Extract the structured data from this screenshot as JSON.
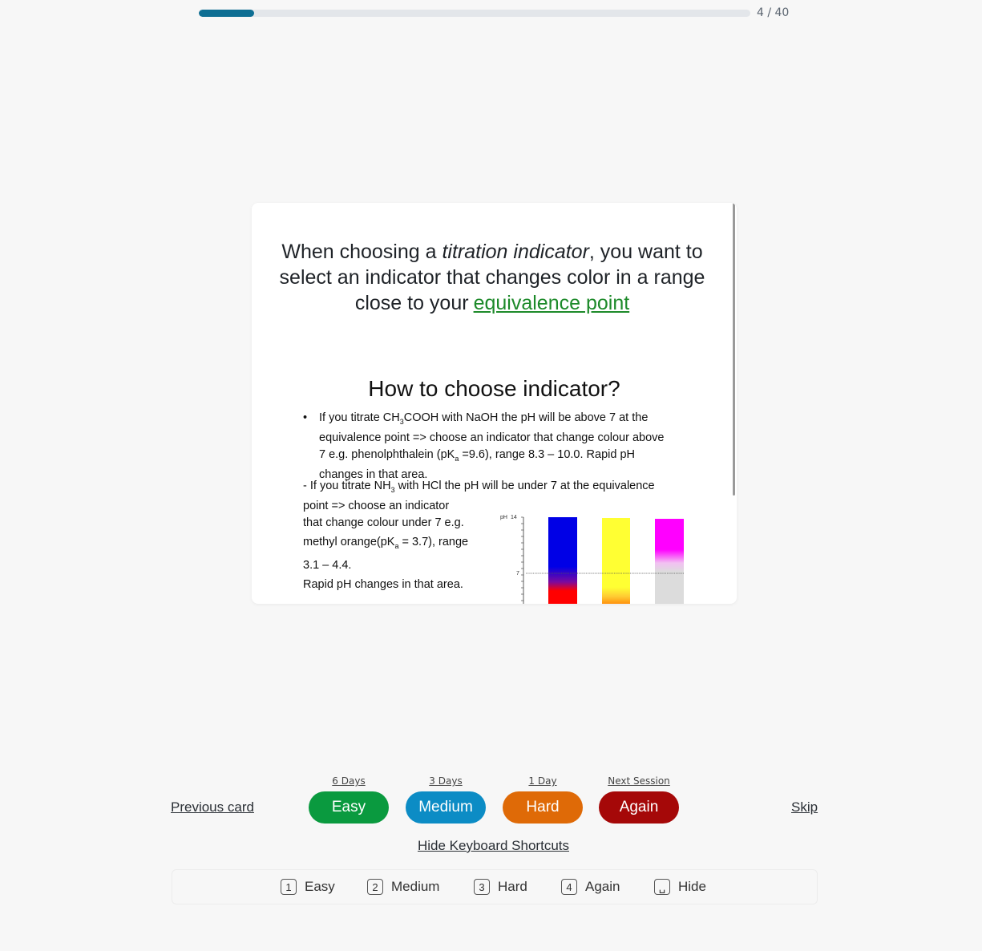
{
  "progress": {
    "current_label": "4 / 40",
    "fraction": 0.1
  },
  "card": {
    "question_pre": "When choosing a ",
    "question_term": "titration indicator",
    "question_mid": ", you want to select an indicator that changes color in a range close to your",
    "question_link": "equivalence point",
    "slide": {
      "title": "How to choose indicator?",
      "bullet_a": "If you titrate CH",
      "bullet_sub1": "3",
      "bullet_b": "COOH with NaOH the pH will be above 7 at the equivalence point => choose an indicator that change colour above 7 e.g. phenolphthalein (pK",
      "bullet_sub2": "a",
      "bullet_c": " =9.6), range 8.3 – 10.0. Rapid pH changes in that area.",
      "para2_a": "- If you titrate NH",
      "para2_sub": "3",
      "para2_b": " with HCl the pH will be under 7 at the equivalence point => choose an indicator",
      "para3_line1": "that change colour under 7 e.g.",
      "para3_line2a": "methyl orange(pK",
      "para3_sub": "a",
      "para3_line2b": " = 3.7), range",
      "para3_line3": "3.1 – 4.4.",
      "para3_line4": "Rapid pH changes in that area.",
      "chart_ph_label": "pH",
      "chart_tick_14": "14",
      "chart_tick_7": "7"
    }
  },
  "rating": {
    "easy": {
      "interval": "6 Days",
      "label": "Easy",
      "color": "#0a9a3f"
    },
    "medium": {
      "interval": "3 Days",
      "label": "Medium",
      "color": "#0c8cc5"
    },
    "hard": {
      "interval": "1 Day",
      "label": "Hard",
      "color": "#df6a07"
    },
    "again": {
      "interval": "Next Session",
      "label": "Again",
      "color": "#a50808"
    }
  },
  "nav": {
    "previous": "Previous card",
    "skip": "Skip",
    "hide_shortcuts": "Hide Keyboard Shortcuts"
  },
  "shortcuts": [
    {
      "key": "1",
      "label": "Easy"
    },
    {
      "key": "2",
      "label": "Medium"
    },
    {
      "key": "3",
      "label": "Hard"
    },
    {
      "key": "4",
      "label": "Again"
    },
    {
      "key": "␣",
      "label": "Hide"
    }
  ]
}
